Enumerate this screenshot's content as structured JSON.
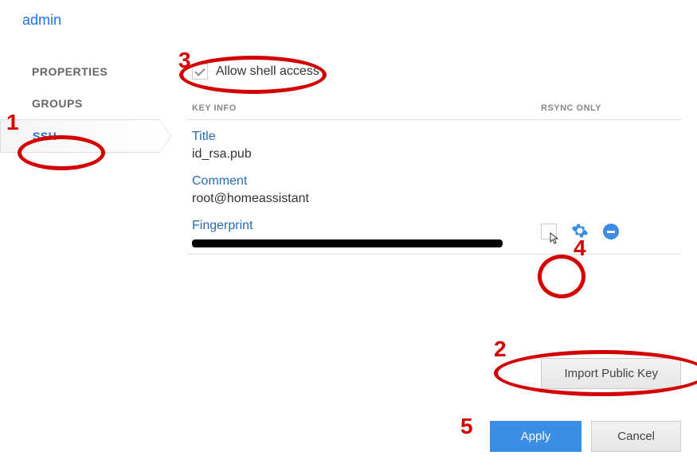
{
  "breadcrumb": "admin",
  "sidebar": {
    "items": [
      {
        "label": "PROPERTIES",
        "active": false
      },
      {
        "label": "GROUPS",
        "active": false
      },
      {
        "label": "SSH",
        "active": true
      }
    ]
  },
  "allow_shell": {
    "label": "Allow shell access",
    "checked": true
  },
  "table": {
    "header_keyinfo": "KEY INFO",
    "header_rsync": "RSYNC ONLY"
  },
  "key": {
    "title_label": "Title",
    "title_value": "id_rsa.pub",
    "comment_label": "Comment",
    "comment_value": "root@homeassistant",
    "fingerprint_label": "Fingerprint",
    "rsync_only": false
  },
  "buttons": {
    "import": "Import Public Key",
    "apply": "Apply",
    "cancel": "Cancel"
  },
  "annotations": {
    "n1": "1",
    "n2": "2",
    "n3": "3",
    "n4": "4",
    "n5": "5"
  }
}
